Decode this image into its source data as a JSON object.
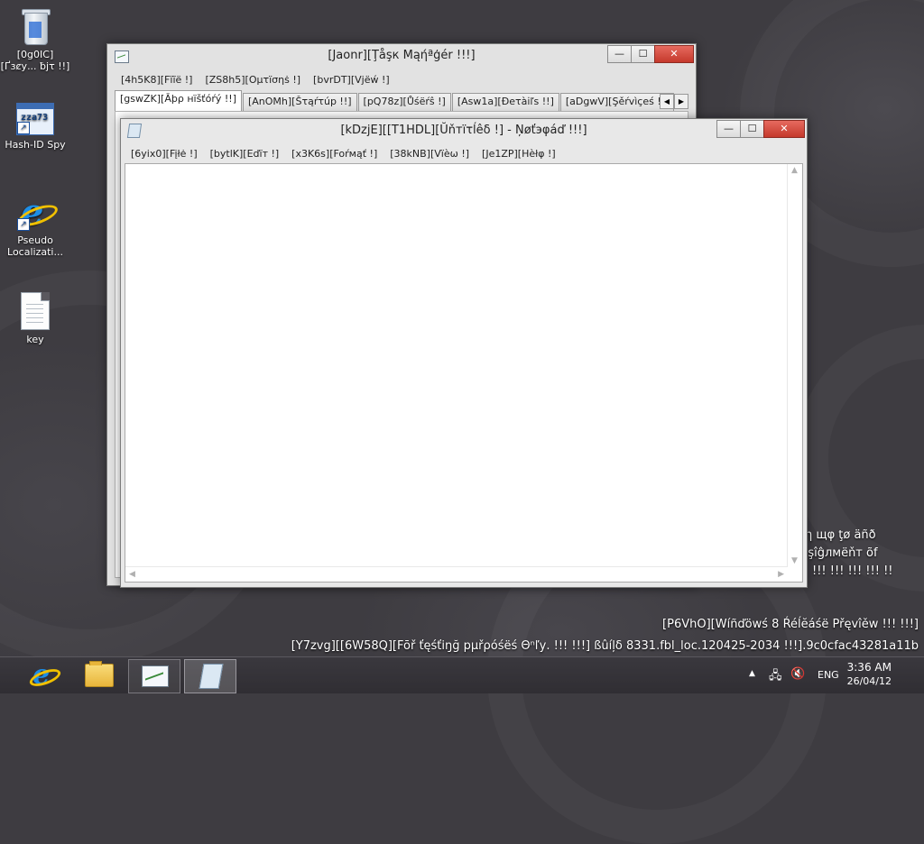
{
  "desktop": {
    "icons": [
      {
        "label": "[0g0IC][Ґзȼу... ƀjτ !!]"
      },
      {
        "label": "Hash-ID Spy",
        "glyph": "zza73"
      },
      {
        "label": "Pseudo Localizati..."
      },
      {
        "label": "key"
      }
    ]
  },
  "task_manager": {
    "title": "[Jaonr][Ţåşк Мąήªģér !!!]",
    "menu": [
      "[4h5K8][Fïĩё !]",
      "[ZS8h5][Ομτїσηṡ !]",
      "[bvrDT][Vjёẃ !]"
    ],
    "tabs": [
      "[gswZK][Āþρ нїšťóŕý !!]",
      "[AnOMh][Šτąŕτúр !!]",
      "[pQ78z][Ůśёŕŝ !]",
      "[Asw1a][Ðеτàіľѕ !!]",
      "[aDgwV][Şěŕvìçеś !!]"
    ],
    "buttons": {
      "minimize": "—",
      "maximize": "☐",
      "close": "✕"
    }
  },
  "notepad": {
    "title": "[kDzjE][[T1HDL][Ŭňтїτĺêδ !] - Ņøťэφáď !!!]",
    "menu": [
      "[6yix0][Fįłė !]",
      "[bytlK][Eďїт !]",
      "[x3K6s][Foŕмąť !]",
      "[38kNB][Vïèω !]",
      "[Je1ZP][Hèłφ !]"
    ],
    "content": "",
    "buttons": {
      "minimize": "—",
      "maximize": "☐",
      "close": "✕"
    }
  },
  "background_text": {
    "line1": "øη щφ ţø äñð",
    "line2": "и àšşîĝлмëňт õf",
    "line3": "!!! !!! !!! !!! !!"
  },
  "watermark": {
    "line1": "[P6VhO][Wíñďöwś 8 Ŕéĺĕáśë Přęvîěw !!! !!!]",
    "line2": "[Y7zvg][[6W58Q][Fōř ťęśťiŋğ pµřρóśëś Θⁿľу. !!! !!!] ßûíļδ 8331.fbl_loc.120425-2034 !!!].9c0cfac43281a11b"
  },
  "taskbar": {
    "language": "ENG",
    "time": "3:36 AM",
    "date": "26/04/12"
  }
}
